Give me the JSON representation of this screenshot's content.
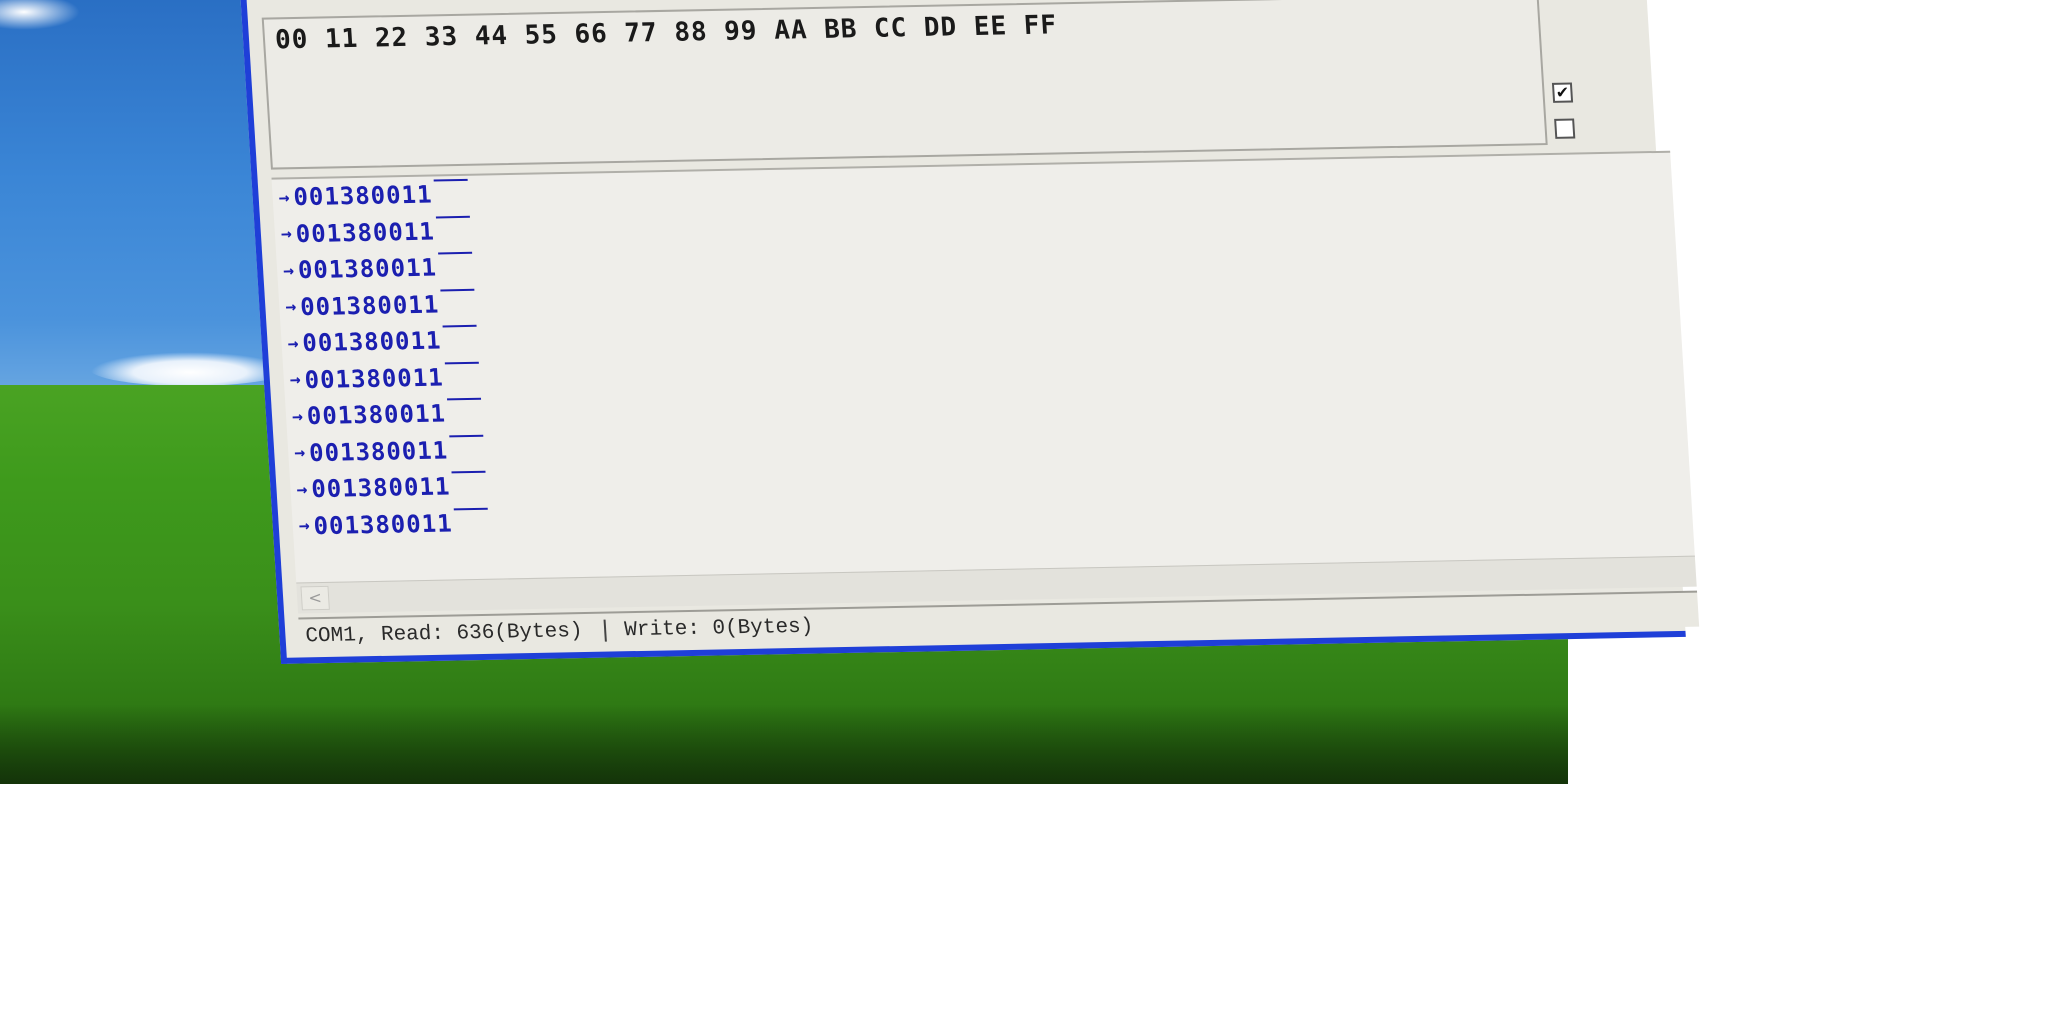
{
  "terminal": {
    "send_text": "00 11 22 33 44 55 66 77 88 99 AA BB CC DD EE FF",
    "checkboxes": [
      {
        "checked": true,
        "mark": "✔"
      },
      {
        "checked": false,
        "mark": ""
      }
    ],
    "receive_lines": [
      {
        "arrow": "→",
        "text": "001380011"
      },
      {
        "arrow": "→",
        "text": "001380011"
      },
      {
        "arrow": "→",
        "text": "001380011"
      },
      {
        "arrow": "→",
        "text": "001380011"
      },
      {
        "arrow": "→",
        "text": "001380011"
      },
      {
        "arrow": "→",
        "text": "001380011"
      },
      {
        "arrow": "→",
        "text": "001380011"
      },
      {
        "arrow": "→",
        "text": "001380011"
      },
      {
        "arrow": "→",
        "text": "001380011"
      },
      {
        "arrow": "→",
        "text": "001380011"
      }
    ],
    "scroll_left_glyph": "<",
    "status": {
      "read": "COM1, Read: 636(Bytes)",
      "write": "Write: 0(Bytes)"
    }
  },
  "colors": {
    "receive_text": "#1b1fb0",
    "window_border": "#1f3fd8"
  }
}
